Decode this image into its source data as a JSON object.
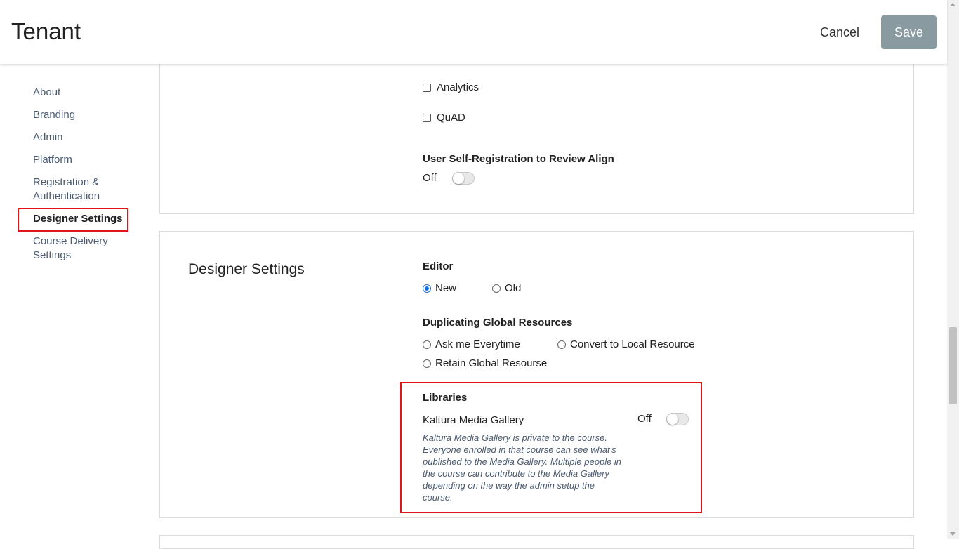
{
  "header": {
    "title": "Tenant",
    "cancel_label": "Cancel",
    "save_label": "Save"
  },
  "nav": {
    "items": [
      {
        "label": "About"
      },
      {
        "label": "Branding"
      },
      {
        "label": "Admin"
      },
      {
        "label": "Platform"
      },
      {
        "label": "Registration & Authentication"
      },
      {
        "label": "Designer Settings"
      },
      {
        "label": "Course Delivery Settings"
      }
    ],
    "active": "Designer Settings"
  },
  "prev_section": {
    "checkboxes": [
      {
        "label": "Analytics",
        "checked": false
      },
      {
        "label": "QuAD",
        "checked": false
      }
    ],
    "self_registration": {
      "label": "User Self-Registration to Review Align",
      "state": "Off"
    }
  },
  "designer": {
    "title": "Designer Settings",
    "editor": {
      "label": "Editor",
      "options": [
        {
          "label": "New",
          "checked": true
        },
        {
          "label": "Old",
          "checked": false
        }
      ]
    },
    "duplicating": {
      "label": "Duplicating Global Resources",
      "options": [
        {
          "label": "Ask me Everytime",
          "checked": false
        },
        {
          "label": "Convert to Local Resource",
          "checked": false
        },
        {
          "label": "Retain Global Resourse",
          "checked": false
        }
      ]
    },
    "libraries": {
      "label": "Libraries",
      "kaltura": {
        "label": "Kaltura Media Gallery",
        "state": "Off",
        "description": "Kaltura Media Gallery is private to the course. Everyone enrolled in that course can see what's published to the Media Gallery. Multiple people in the course can contribute to the Media Gallery depending on the way the admin setup the course."
      }
    }
  },
  "colors": {
    "highlight": "#e0141b",
    "save_bg": "#8a9aa1",
    "nav_link": "#4a5a70",
    "radio_accent": "#1a73e8"
  }
}
